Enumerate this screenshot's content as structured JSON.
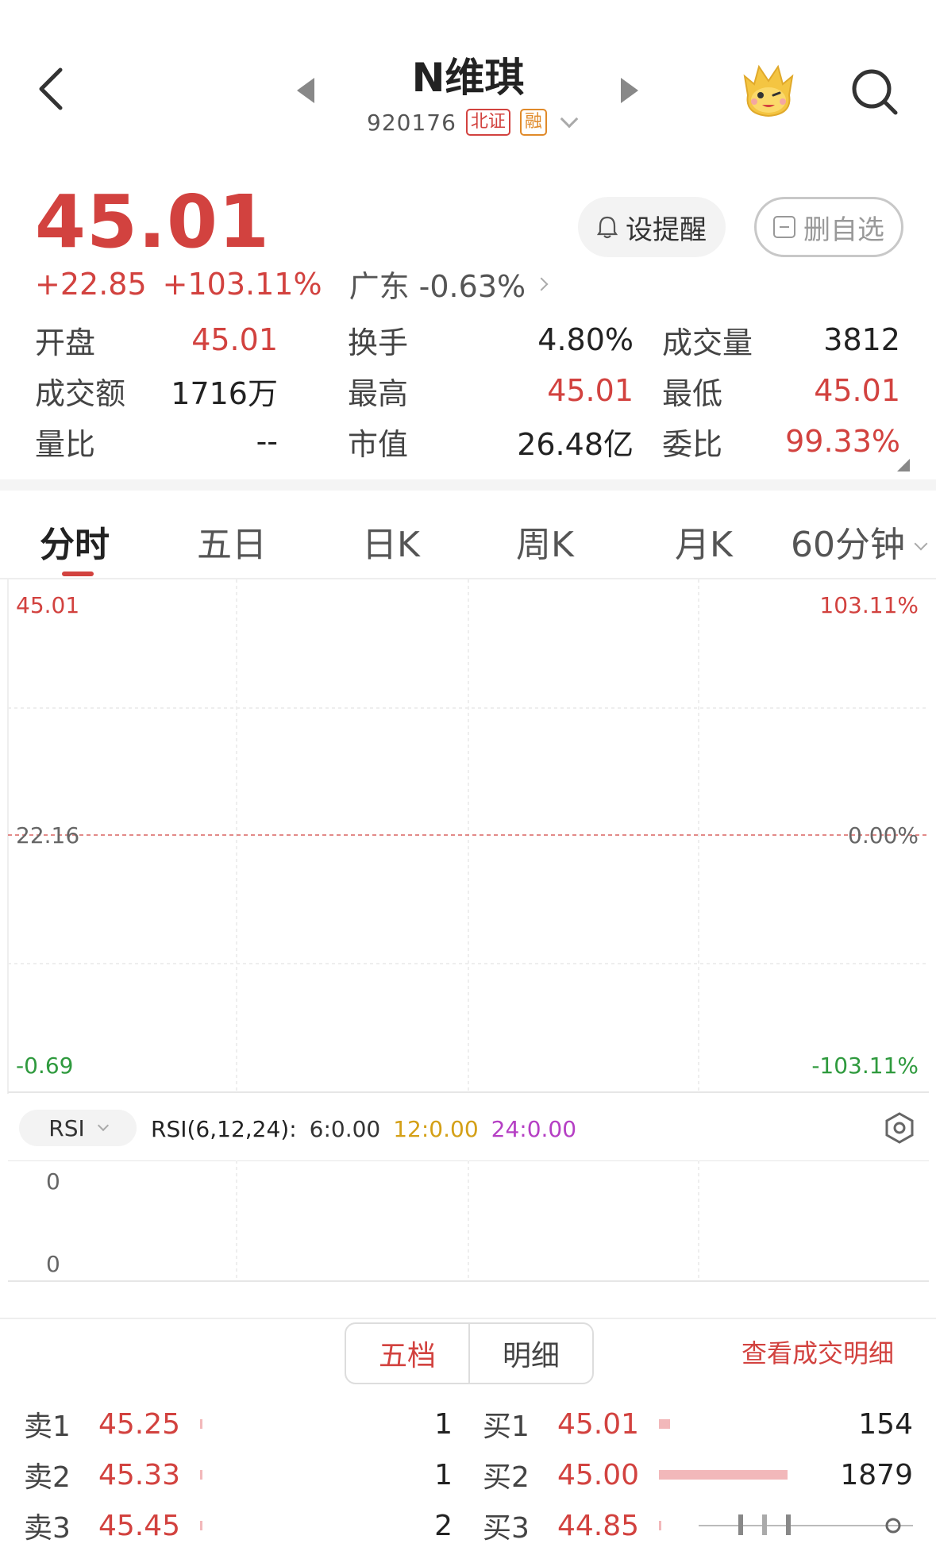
{
  "header": {
    "stock_name": "N维琪",
    "code": "920176",
    "tag_exchange": "北证",
    "tag_margin": "融"
  },
  "quote": {
    "price": "45.01",
    "change": "+22.85",
    "change_pct": "+103.11%",
    "sector_name": "广东",
    "sector_change": "-0.63%"
  },
  "buttons": {
    "alert_label": "设提醒",
    "remove_watch_label": "删自选"
  },
  "stats": [
    [
      {
        "label": "开盘",
        "value": "45.01",
        "color": "red"
      },
      {
        "label": "换手",
        "value": "4.80%",
        "color": "dark"
      },
      {
        "label": "成交量",
        "value": "3812",
        "color": "dark"
      }
    ],
    [
      {
        "label": "成交额",
        "value": "1716万",
        "color": "dark"
      },
      {
        "label": "最高",
        "value": "45.01",
        "color": "red"
      },
      {
        "label": "最低",
        "value": "45.01",
        "color": "red"
      }
    ],
    [
      {
        "label": "量比",
        "value": "--",
        "color": "dark"
      },
      {
        "label": "市值",
        "value": "26.48亿",
        "color": "dark"
      },
      {
        "label": "委比",
        "value": "99.33%",
        "color": "red"
      }
    ]
  ],
  "tabs": [
    "分时",
    "五日",
    "日K",
    "周K",
    "月K",
    "60分钟"
  ],
  "active_tab": "分时",
  "chart": {
    "price_top": "45.01",
    "price_mid": "22.16",
    "price_bottom": "-0.69",
    "pct_top": "103.11%",
    "pct_mid": "0.00%",
    "pct_bottom": "-103.11%"
  },
  "rsi": {
    "selector_label": "RSI",
    "params_label": "RSI(6,12,24):",
    "rsi6": "6:0.00",
    "rsi12": "12:0.00",
    "rsi24": "24:0.00",
    "rsi6_color": "#333333",
    "rsi12_color": "#d4a017",
    "rsi24_color": "#b53fc4",
    "axis_top": "0",
    "axis_bottom": "0"
  },
  "order_book": {
    "segment_active": "五档",
    "segment_other": "明细",
    "detail_link": "查看成交明细",
    "sells": [
      {
        "label": "卖1",
        "price": "45.25",
        "volume": "1"
      },
      {
        "label": "卖2",
        "price": "45.33",
        "volume": "1"
      },
      {
        "label": "卖3",
        "price": "45.45",
        "volume": "2"
      }
    ],
    "buys": [
      {
        "label": "买1",
        "price": "45.01",
        "volume": "154"
      },
      {
        "label": "买2",
        "price": "45.00",
        "volume": "1879"
      },
      {
        "label": "买3",
        "price": "44.85",
        "volume": ""
      }
    ]
  },
  "colors": {
    "up": "#d2423f",
    "down": "#2f9a3e",
    "accent": "#d2423f"
  }
}
